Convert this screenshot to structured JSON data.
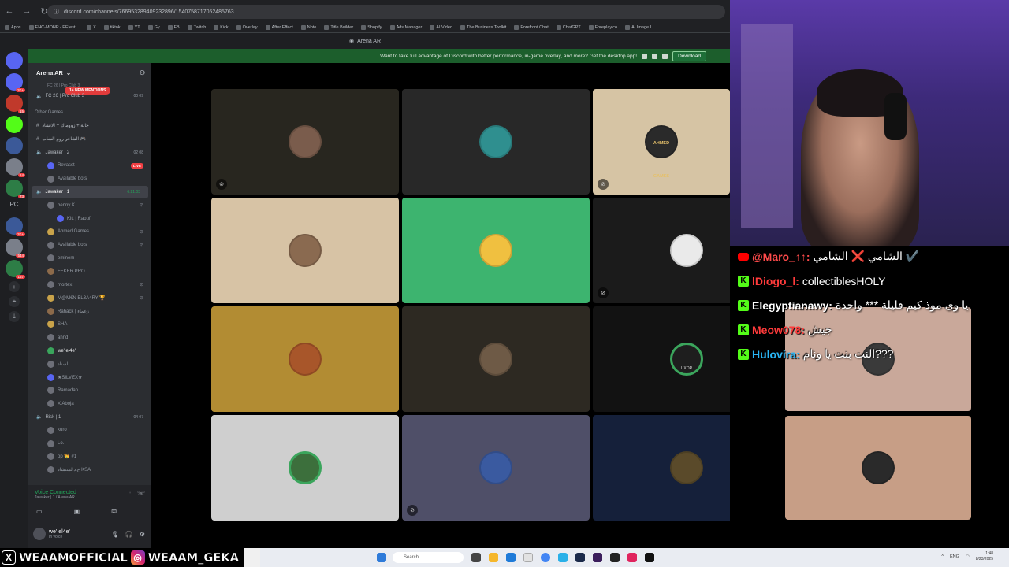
{
  "browser": {
    "url": "discord.com/channels/766953289409232896/1540758717052485763",
    "bookmarks": [
      "Apps",
      "EHC-MOHP - EEtest...",
      "X",
      "tiktok",
      "YT",
      "Gy",
      "FB",
      "Twitch",
      "Kick",
      "Overlay",
      "After Effect",
      "Note",
      "Title Builder",
      "Shopify",
      "Ads Manager",
      "AI Video",
      "The Business Toolkit",
      "Forefront Chat",
      "ChatGPT",
      "Foreplay.co",
      "AI Image I"
    ],
    "tab_title": "Arena AR"
  },
  "banner": {
    "text": "Want to take full advantage of Discord with better performance, in-game overlay, and more? Get the desktop app!",
    "button": "Download"
  },
  "guilds": [
    {
      "badge": "1K+"
    },
    {
      "badge": "15"
    },
    {
      "badge": ""
    },
    {
      "badge": ""
    },
    {
      "badge": "14"
    },
    {
      "badge": "73"
    }
  ],
  "guild_pc": "PC",
  "guilds2": [
    {
      "badge": "1K+"
    },
    {
      "badge": "544"
    },
    {
      "badge": "167"
    }
  ],
  "server": {
    "name": "Arena AR",
    "mentions": "14 NEW MENTIONS"
  },
  "channels": {
    "clipped_top": "FC 26 | Pro Club 3",
    "fc26": "FC 26 | Pro Club 3",
    "fc26_count": "00 09",
    "cat_other": "Other Games",
    "c_arabic1": "جالة + زووماك + الانشاد",
    "c_arabic2": "الشاعر روم الشاب 🎮",
    "jawaker2": "Jawaker | 2",
    "jawaker2_count": "02 08",
    "revasst": "Revasst",
    "live": "LIVE",
    "available_bots1": "Available bots",
    "jawaker1": "Jawaker | 1",
    "jawaker1_count": "6:21:03",
    "users": [
      "benny K",
      "Kitt | Raouf",
      "Ahmed Games",
      "Available bots",
      "eminem",
      "FEKER PRO",
      "morteх",
      "M@M€N EL3A4RY 🏆",
      "Rahack | زعماء",
      "SHA",
      "ahnd",
      "we' el4e'",
      "السناد",
      "★SILVEX★",
      "Ramadan",
      "X Aboja"
    ],
    "risk1": "Risk | 1",
    "risk1_count": "04 07",
    "risk_users": [
      "kuro",
      "Lo.",
      "op 👑 #1",
      "ع.دالستشاد KSA"
    ]
  },
  "voice": {
    "title": "Voice Connected",
    "sub": "Jawaker | 1 / Arena AR"
  },
  "user": {
    "name": "we' el4e'",
    "status": "In voice"
  },
  "tiles": [
    {
      "bg": "#28261f",
      "av": "#7a5c4c"
    },
    {
      "bg": "#282828",
      "av": "#2f8f8f"
    },
    {
      "bg": "#d6c4a4",
      "av": "#2a2a2a"
    },
    {
      "bg": "#d7c3a5",
      "av": "#8a6a50"
    },
    {
      "bg": "#3db46f",
      "av": "#f0c040"
    },
    {
      "bg": "#1b1b1b",
      "av": "#eaeaea"
    },
    {
      "bg": "#b28c33",
      "av": "#a8562a"
    },
    {
      "bg": "#2d2922",
      "av": "#6e5a46"
    },
    {
      "bg": "#121212",
      "av": "#1e1e1e"
    },
    {
      "bg": "#c9a89a",
      "av": "#3a3a3a"
    },
    {
      "bg": "#cfcfcf",
      "av": "#3c6f3c"
    },
    {
      "bg": "#4f4f68",
      "av": "#3a5aa0"
    },
    {
      "bg": "#15203a",
      "av": "#5a4a2a"
    },
    {
      "bg": "#c79e86",
      "av": "#2a2a2a"
    }
  ],
  "tile_ahmed": "AHMED GAMES",
  "tile_uxor": "UXOR",
  "chat": [
    {
      "platform": "youtube",
      "user": "@Maro_↑↑:",
      "color": "#ff4b4b",
      "text": "الشامي ❌ الشامي ✔️"
    },
    {
      "platform": "kick",
      "user": "lDiogo_l:",
      "color": "#ff3b3b",
      "text": "collectiblesHOLY"
    },
    {
      "platform": "kick",
      "user": "Elegyptianawy:",
      "color": "#ffffff",
      "text": "يا وى موذ كيم قليلة *** واحدة"
    },
    {
      "platform": "kick",
      "user": "Meow078:",
      "color": "#ff3b3b",
      "text": "جيش"
    },
    {
      "platform": "kick",
      "user": "Hulovira:",
      "color": "#29b6f6",
      "text": "النت بنت يا ونام???"
    }
  ],
  "social": {
    "x_handle": "WEAAMOFFICIAL",
    "ig_handle": "WEAAM_GEKA"
  },
  "taskbar": {
    "search": "Search",
    "lang": "ENG",
    "time": "1:48",
    "date": "8/23/2025"
  }
}
